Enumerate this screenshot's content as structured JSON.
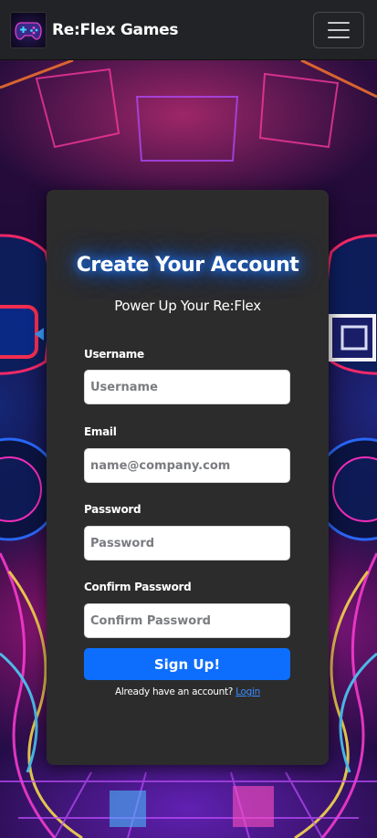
{
  "navbar": {
    "brand_name": "Re:Flex Games",
    "logo_icon": "gamepad-icon",
    "menu_icon": "hamburger-menu-icon"
  },
  "card": {
    "title": "Create Your Account",
    "subtitle": "Power Up Your Re:Flex",
    "fields": [
      {
        "label": "Username",
        "placeholder": "Username",
        "value": ""
      },
      {
        "label": "Email",
        "placeholder": "name@company.com",
        "value": ""
      },
      {
        "label": "Password",
        "placeholder": "Password",
        "value": ""
      },
      {
        "label": "Confirm Password",
        "placeholder": "Confirm Password",
        "value": ""
      }
    ],
    "submit_label": "Sign Up!",
    "login_prompt": "Already have an account?",
    "login_link": "Login"
  },
  "colors": {
    "navbar_bg": "#222326",
    "card_bg": "#2c2c2d",
    "primary": "#0d6efd",
    "title_glow": "#1d7cff",
    "link": "#3a8cff"
  }
}
